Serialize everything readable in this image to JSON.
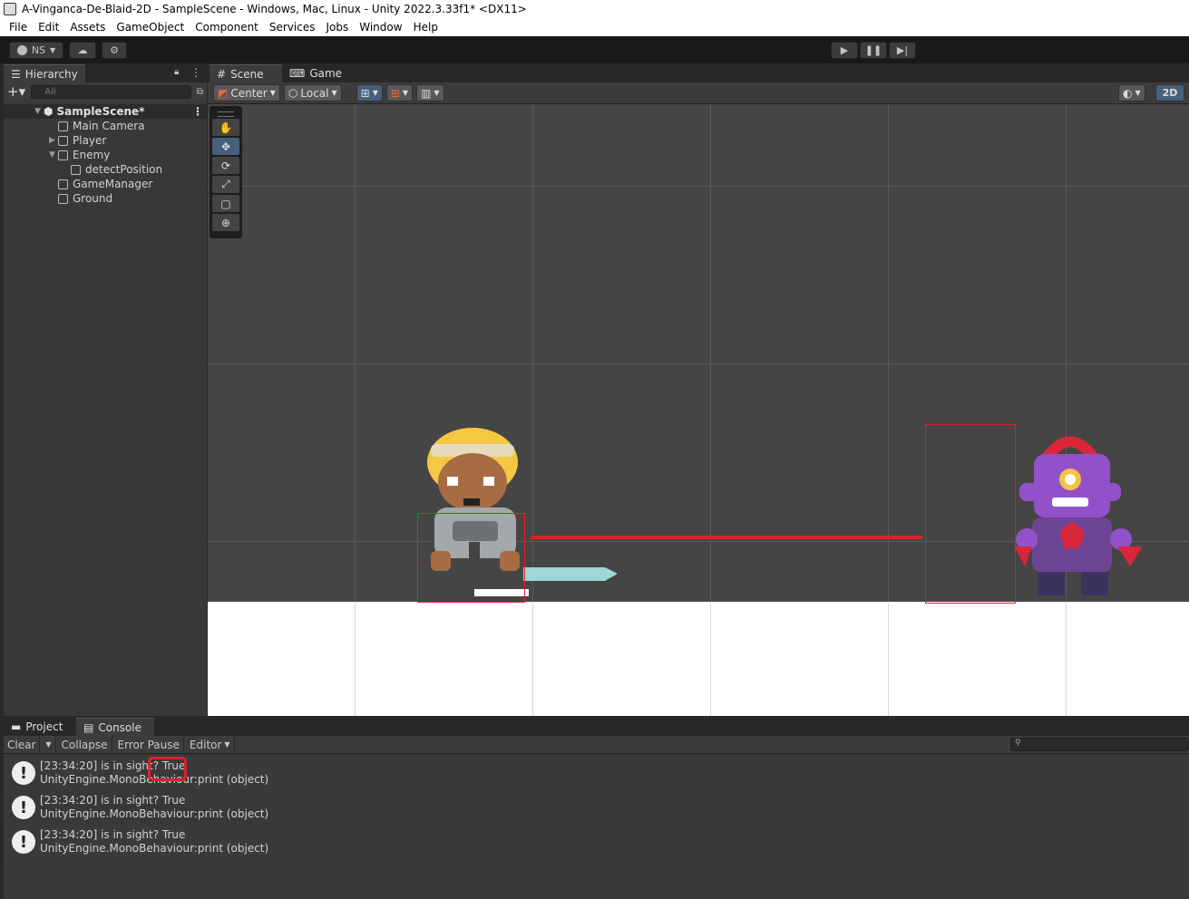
{
  "window": {
    "title": "A-Vinganca-De-Blaid-2D - SampleScene - Windows, Mac, Linux - Unity 2022.3.33f1* <DX11>"
  },
  "menu": [
    "File",
    "Edit",
    "Assets",
    "GameObject",
    "Component",
    "Services",
    "Jobs",
    "Window",
    "Help"
  ],
  "toolbar": {
    "account": "NS"
  },
  "hierarchy": {
    "tab": "Hierarchy",
    "search_placeholder": "All",
    "scene": "SampleScene*",
    "items": [
      {
        "label": "Main Camera",
        "indent": 1,
        "arrow": ""
      },
      {
        "label": "Player",
        "indent": 1,
        "arrow": "▶"
      },
      {
        "label": "Enemy",
        "indent": 1,
        "arrow": "▼"
      },
      {
        "label": "detectPosition",
        "indent": 2,
        "arrow": ""
      },
      {
        "label": "GameManager",
        "indent": 1,
        "arrow": ""
      },
      {
        "label": "Ground",
        "indent": 1,
        "arrow": ""
      }
    ]
  },
  "scene": {
    "tabs": {
      "scene": "Scene",
      "game": "Game"
    },
    "pivot": "Center",
    "space": "Local",
    "mode_2d": "2D"
  },
  "console": {
    "tabs": {
      "project": "Project",
      "console": "Console"
    },
    "buttons": {
      "clear": "Clear",
      "collapse": "Collapse",
      "error_pause": "Error Pause",
      "editor": "Editor"
    },
    "logs": [
      {
        "line1": "[23:34:20] is in sight? True",
        "line2": "UnityEngine.MonoBehaviour:print (object)"
      },
      {
        "line1": "[23:34:20] is in sight? True",
        "line2": "UnityEngine.MonoBehaviour:print (object)"
      },
      {
        "line1": "[23:34:20] is in sight? True",
        "line2": "UnityEngine.MonoBehaviour:print (object)"
      }
    ]
  },
  "colors": {
    "highlight": "#e0202a",
    "scene_bg": "#454545",
    "accent": "#46607c"
  }
}
